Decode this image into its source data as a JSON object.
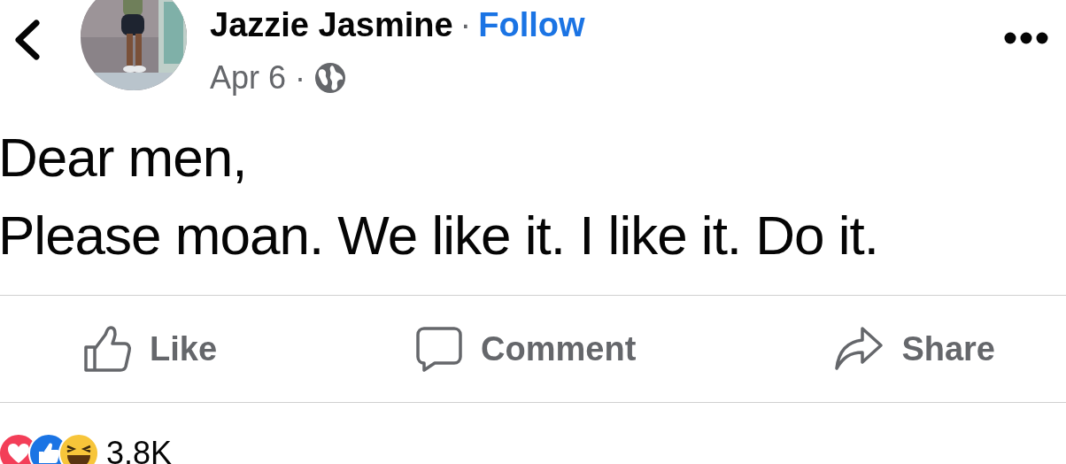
{
  "header": {
    "author": "Jazzie Jasmine",
    "separator": "·",
    "follow": "Follow",
    "date": "Apr 6",
    "date_separator": "·"
  },
  "post_text": [
    "Dear men,",
    "Please moan. We like it. I like it. Do it."
  ],
  "actions": [
    {
      "kind": "like",
      "label": "Like"
    },
    {
      "kind": "comment",
      "label": "Comment"
    },
    {
      "kind": "share",
      "label": "Share"
    }
  ],
  "reactions": {
    "types": [
      {
        "kind": "love"
      },
      {
        "kind": "like"
      },
      {
        "kind": "haha"
      }
    ],
    "count": "3.8K"
  }
}
